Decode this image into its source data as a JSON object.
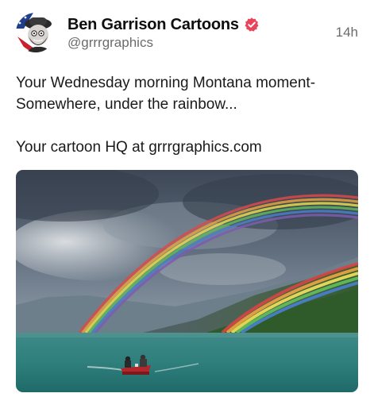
{
  "post": {
    "author": {
      "display_name": "Ben Garrison Cartoons",
      "handle": "@grrrgraphics",
      "verified": true,
      "avatar_icon": "cartoon-character-avatar-icon"
    },
    "timestamp": "14h",
    "body": {
      "line1": "Your Wednesday morning Montana moment-",
      "line2": "Somewhere, under the rainbow...",
      "line3": "Your cartoon HQ at grrrgraphics.com"
    },
    "media": {
      "kind": "photo"
    }
  },
  "colors": {
    "verified_badge": "#e8445a",
    "name": "#0f0f0f",
    "secondary_text": "#6b6b6b",
    "background": "#ffffff"
  }
}
